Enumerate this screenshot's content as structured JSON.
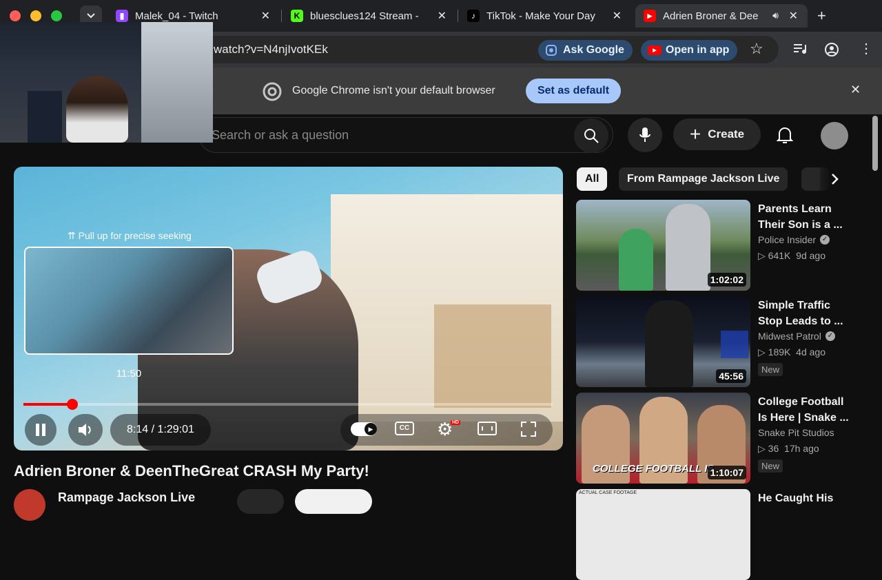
{
  "tabs": [
    {
      "title": "Malek_04 - Twitch",
      "favicon": "twitch-icon",
      "color": "#9146ff"
    },
    {
      "title": "bluesclues124 Stream -",
      "favicon": "kick-icon",
      "color": "#53fc18"
    },
    {
      "title": "TikTok - Make Your Day",
      "favicon": "tiktok-icon",
      "color": "#000000"
    },
    {
      "title": "Adrien Broner & Dee",
      "favicon": "youtube-icon",
      "color": "#ff0000"
    }
  ],
  "toolbar": {
    "url": "watch?v=N4njIvotKEk",
    "ask_google": "Ask Google",
    "open_in_app": "Open in app"
  },
  "infobar": {
    "message": "Google Chrome isn't your default browser",
    "button": "Set as default"
  },
  "masthead": {
    "search_placeholder": "Search or ask a question",
    "create": "Create"
  },
  "player": {
    "seek_hint": "Pull up for precise seeking",
    "preview_time": "11:50",
    "current_time": "8:14",
    "separator": "/",
    "duration": "1:29:01",
    "progress_fraction": 0.092,
    "hd_badge": "HD"
  },
  "video": {
    "title": "Adrien Broner & DeenTheGreat CRASH My Party!",
    "channel_partial": "Rampage Jackson Live"
  },
  "chips": [
    "All",
    "From Rampage Jackson Live"
  ],
  "recommendations": [
    {
      "title_line1": "Parents Learn",
      "title_line2": "Their Son is a ...",
      "channel": "Police Insider",
      "views": "641K",
      "age": "9d ago",
      "duration": "1:02:02",
      "badge": ""
    },
    {
      "title_line1": "Simple Traffic",
      "title_line2": "Stop Leads to ...",
      "channel": "Midwest Patrol",
      "views": "189K",
      "age": "4d ago",
      "duration": "45:56",
      "badge": "New"
    },
    {
      "title_line1": "College Football",
      "title_line2": "Is Here | Snake ...",
      "channel": "Snake Pit Studios",
      "views": "36",
      "age": "17h ago",
      "duration": "1:10:07",
      "badge": "New",
      "overlay": "COLLEGE FOOTBALL IS"
    },
    {
      "title_line1": "He Caught His",
      "title_line2": "",
      "channel": "",
      "views": "",
      "age": "",
      "duration": "",
      "badge": "",
      "overlay": "ACTUAL CASE FOOTAGE"
    }
  ],
  "colors": {
    "youtube_red": "#ff0000",
    "chip_active_bg": "#f1f1f1",
    "set_default_bg": "#a8c7fa"
  }
}
